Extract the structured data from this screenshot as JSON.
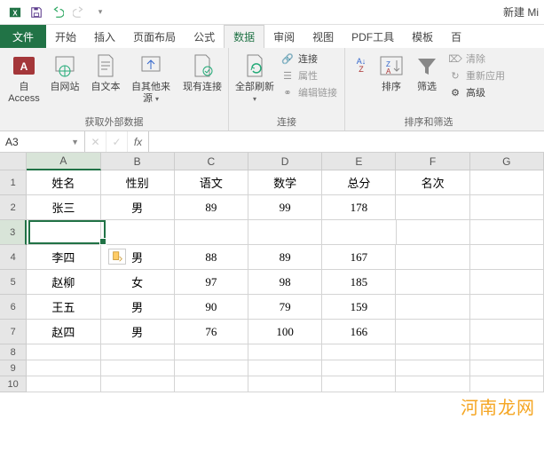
{
  "titlebar": {
    "title": "新建 Mi"
  },
  "tabs": {
    "file": "文件",
    "items": [
      "开始",
      "插入",
      "页面布局",
      "公式",
      "数据",
      "审阅",
      "视图",
      "PDF工具",
      "模板",
      "百"
    ],
    "active_index": 4
  },
  "ribbon": {
    "group_ext": {
      "label": "获取外部数据",
      "access": "自 Access",
      "web": "自网站",
      "text": "自文本",
      "other": "自其他来源",
      "existing": "现有连接"
    },
    "group_conn": {
      "label": "连接",
      "refresh": "全部刷新",
      "connect": "连接",
      "props": "属性",
      "editlinks": "编辑链接"
    },
    "group_sort": {
      "label": "排序和筛选",
      "sort": "排序",
      "filter": "筛选",
      "clear": "清除",
      "reapply": "重新应用",
      "advanced": "高级"
    }
  },
  "formula_bar": {
    "name": "A3"
  },
  "grid": {
    "columns": [
      "A",
      "B",
      "C",
      "D",
      "E",
      "F",
      "G"
    ],
    "rows": [
      "1",
      "2",
      "3",
      "4",
      "5",
      "6",
      "7",
      "8",
      "9",
      "10"
    ],
    "selected_col": 0,
    "selected_row": 2,
    "data": [
      [
        "姓名",
        "性别",
        "语文",
        "数学",
        "总分",
        "名次",
        ""
      ],
      [
        "张三",
        "男",
        "89",
        "99",
        "178",
        "",
        ""
      ],
      [
        "",
        "",
        "",
        "",
        "",
        "",
        ""
      ],
      [
        "李四",
        "男",
        "88",
        "89",
        "167",
        "",
        ""
      ],
      [
        "赵柳",
        "女",
        "97",
        "98",
        "185",
        "",
        ""
      ],
      [
        "王五",
        "男",
        "90",
        "79",
        "159",
        "",
        ""
      ],
      [
        "赵四",
        "男",
        "76",
        "100",
        "166",
        "",
        ""
      ],
      [
        "",
        "",
        "",
        "",
        "",
        "",
        ""
      ],
      [
        "",
        "",
        "",
        "",
        "",
        "",
        ""
      ],
      [
        "",
        "",
        "",
        "",
        "",
        "",
        ""
      ]
    ]
  },
  "watermark": "河南龙网",
  "chart_data": {
    "type": "table",
    "title": "",
    "columns": [
      "姓名",
      "性别",
      "语文",
      "数学",
      "总分",
      "名次"
    ],
    "rows": [
      {
        "姓名": "张三",
        "性别": "男",
        "语文": 89,
        "数学": 99,
        "总分": 178,
        "名次": null
      },
      {
        "姓名": "李四",
        "性别": "男",
        "语文": 88,
        "数学": 89,
        "总分": 167,
        "名次": null
      },
      {
        "姓名": "赵柳",
        "性别": "女",
        "语文": 97,
        "数学": 98,
        "总分": 185,
        "名次": null
      },
      {
        "姓名": "王五",
        "性别": "男",
        "语文": 90,
        "数学": 79,
        "总分": 159,
        "名次": null
      },
      {
        "姓名": "赵四",
        "性别": "男",
        "语文": 76,
        "数学": 100,
        "总分": 166,
        "名次": null
      }
    ]
  }
}
